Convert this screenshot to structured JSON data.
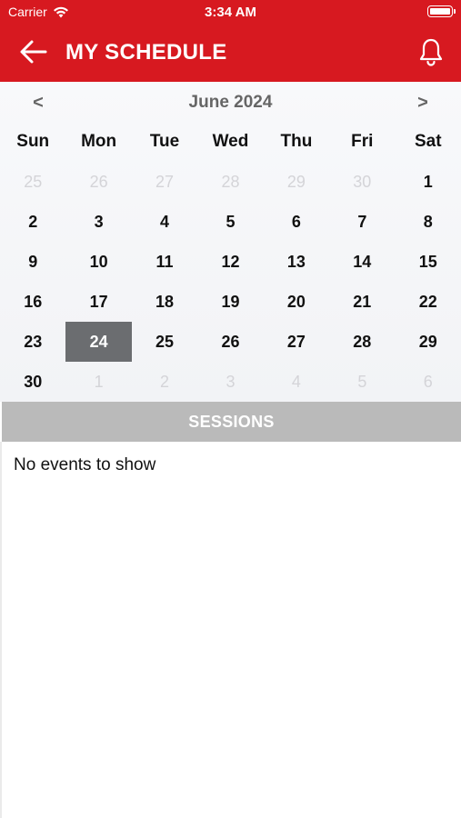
{
  "status_bar": {
    "carrier": "Carrier",
    "time": "3:34 AM"
  },
  "header": {
    "title": "MY SCHEDULE",
    "back_icon": "arrow-left-icon",
    "bell_icon": "bell-icon",
    "color": "#d71920"
  },
  "calendar": {
    "month_label": "June 2024",
    "prev_label": "<",
    "next_label": ">",
    "weekdays": [
      "Sun",
      "Mon",
      "Tue",
      "Wed",
      "Thu",
      "Fri",
      "Sat"
    ],
    "days": [
      {
        "label": "25",
        "muted": true
      },
      {
        "label": "26",
        "muted": true
      },
      {
        "label": "27",
        "muted": true
      },
      {
        "label": "28",
        "muted": true
      },
      {
        "label": "29",
        "muted": true
      },
      {
        "label": "30",
        "muted": true
      },
      {
        "label": "1"
      },
      {
        "label": "2"
      },
      {
        "label": "3"
      },
      {
        "label": "4"
      },
      {
        "label": "5"
      },
      {
        "label": "6"
      },
      {
        "label": "7"
      },
      {
        "label": "8"
      },
      {
        "label": "9"
      },
      {
        "label": "10"
      },
      {
        "label": "11"
      },
      {
        "label": "12"
      },
      {
        "label": "13"
      },
      {
        "label": "14"
      },
      {
        "label": "15"
      },
      {
        "label": "16"
      },
      {
        "label": "17"
      },
      {
        "label": "18"
      },
      {
        "label": "19"
      },
      {
        "label": "20"
      },
      {
        "label": "21"
      },
      {
        "label": "22"
      },
      {
        "label": "23"
      },
      {
        "label": "24",
        "selected": true
      },
      {
        "label": "25"
      },
      {
        "label": "26"
      },
      {
        "label": "27"
      },
      {
        "label": "28"
      },
      {
        "label": "29"
      },
      {
        "label": "30"
      },
      {
        "label": "1",
        "muted": true
      },
      {
        "label": "2",
        "muted": true
      },
      {
        "label": "3",
        "muted": true
      },
      {
        "label": "4",
        "muted": true
      },
      {
        "label": "5",
        "muted": true
      },
      {
        "label": "6",
        "muted": true
      }
    ],
    "selected_color": "#6b6d70"
  },
  "sessions": {
    "title": "SESSIONS",
    "empty_text": "No events to show"
  }
}
